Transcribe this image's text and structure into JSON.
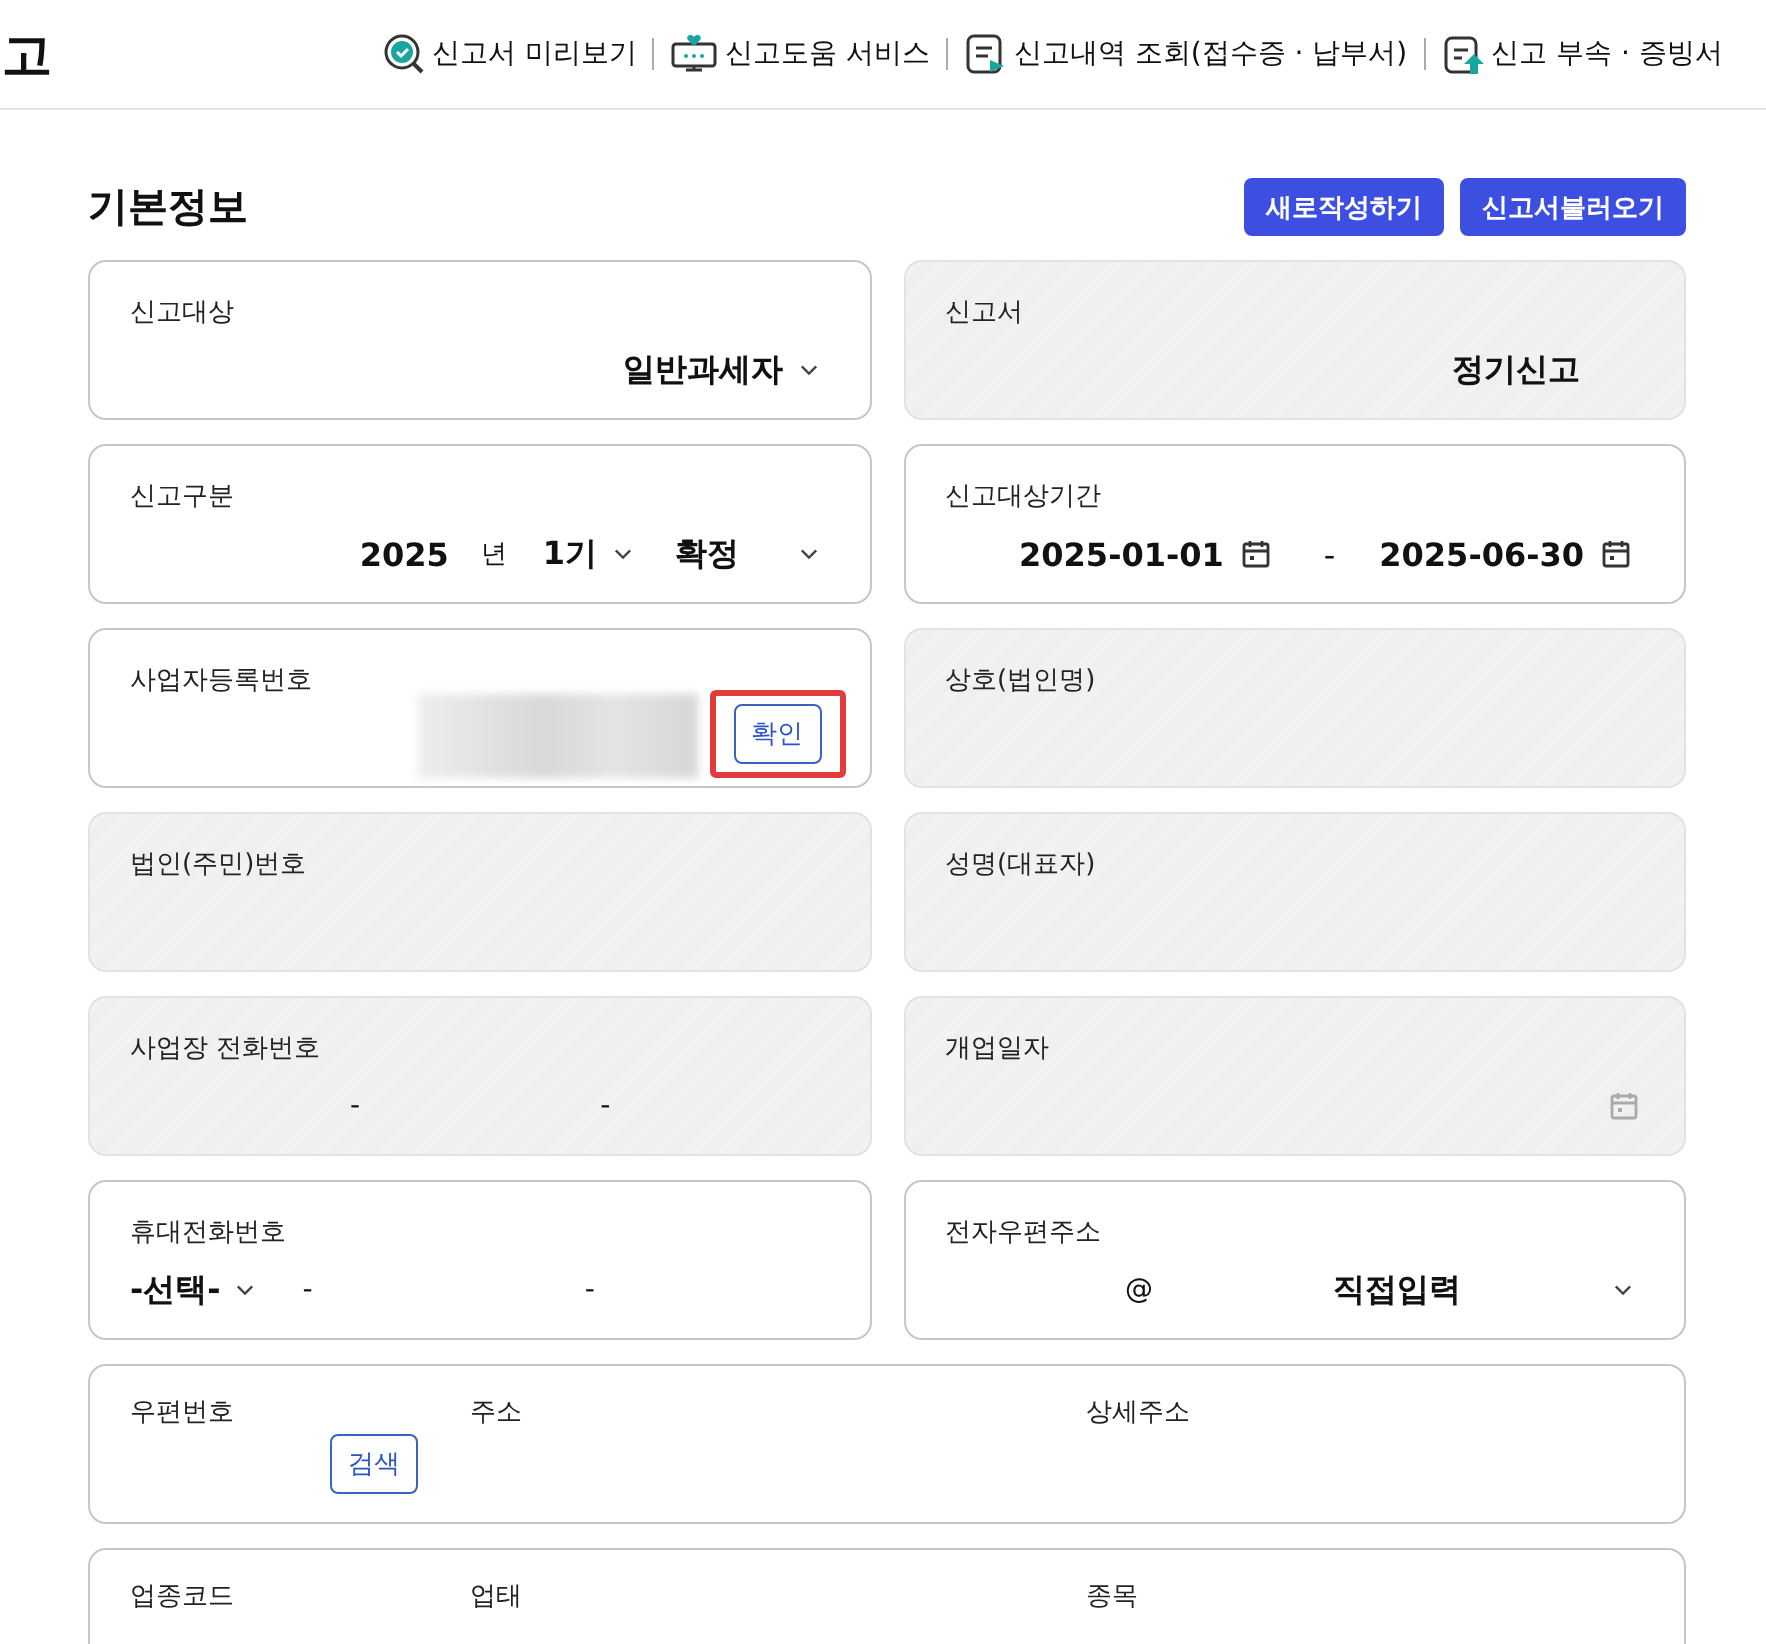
{
  "header": {
    "title": "고",
    "links": [
      {
        "kind": "preview",
        "label": "신고서 미리보기"
      },
      {
        "kind": "help",
        "label": "신고도움 서비스"
      },
      {
        "kind": "history",
        "label": "신고내역 조회(접수증 · 납부서)"
      },
      {
        "kind": "attachment",
        "label": "신고 부속 · 증빙서"
      }
    ]
  },
  "section": {
    "title": "기본정보",
    "buttons": [
      "새로작성하기",
      "신고서불러오기"
    ]
  },
  "cards": [
    {
      "kind": "select",
      "label": "신고대상",
      "value": "일반과세자",
      "disabled": false
    },
    {
      "kind": "text",
      "label": "신고서",
      "value": "정기신고",
      "disabled": true
    },
    {
      "kind": "period",
      "label": "신고구분",
      "year": "2025",
      "year_unit": "년",
      "term": "1기",
      "type": "확정",
      "disabled": false
    },
    {
      "kind": "date_range",
      "label": "신고대상기간",
      "start": "2025-01-01",
      "separator": "-",
      "end": "2025-06-30",
      "disabled": false
    },
    {
      "kind": "verify",
      "label": "사업자등록번호",
      "button": "확인",
      "highlighted": true,
      "disabled": false
    },
    {
      "kind": "text",
      "label": "상호(법인명)",
      "disabled": true
    },
    {
      "kind": "text",
      "label": "법인(주민)번호",
      "disabled": true
    },
    {
      "kind": "text",
      "label": "성명(대표자)",
      "disabled": true
    },
    {
      "kind": "phone",
      "label": "사업장 전화번호",
      "separators": [
        "-",
        "-"
      ],
      "disabled": true
    },
    {
      "kind": "date",
      "label": "개업일자",
      "disabled": true
    },
    {
      "kind": "mobile",
      "label": "휴대전화번호",
      "carrier": "-선택-",
      "separators": [
        "-",
        "-"
      ],
      "disabled": false
    },
    {
      "kind": "email",
      "label": "전자우편주소",
      "at": "@",
      "domain": "직접입력",
      "disabled": false
    },
    {
      "kind": "address",
      "columns": [
        {
          "label": "우편번호",
          "button": "검색"
        },
        {
          "label": "주소"
        },
        {
          "label": "상세주소"
        }
      ],
      "disabled": false
    },
    {
      "kind": "business",
      "columns": [
        {
          "label": "업종코드"
        },
        {
          "label": "업태"
        },
        {
          "label": "종목"
        }
      ],
      "disabled": false
    }
  ]
}
